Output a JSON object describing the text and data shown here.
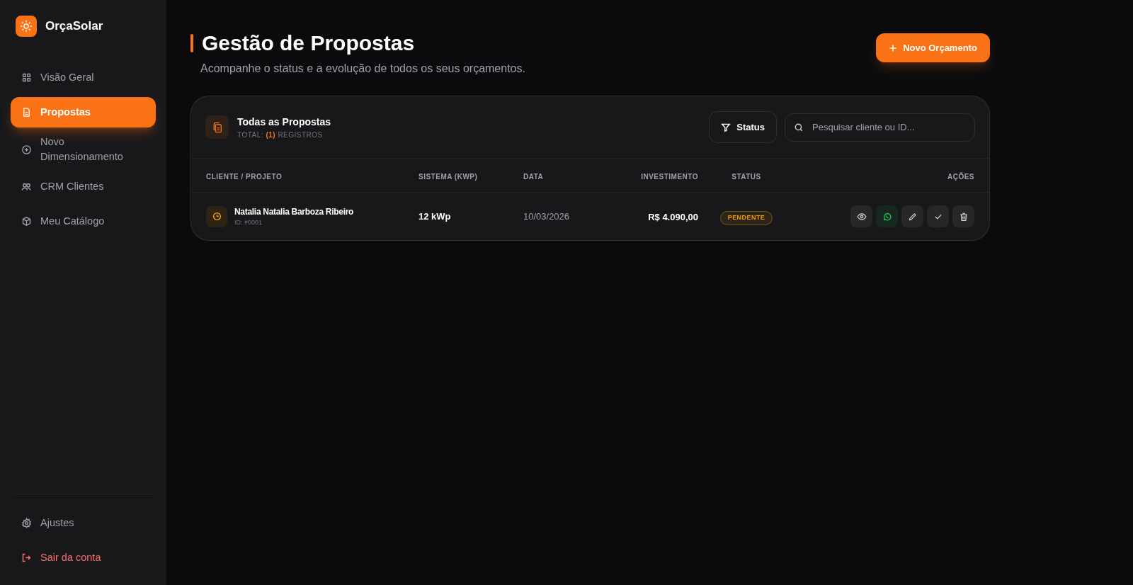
{
  "brand": {
    "name": "OrçaSolar"
  },
  "sidebar": {
    "items": [
      {
        "label": "Visão Geral",
        "selected": false
      },
      {
        "label": "Propostas",
        "selected": true
      },
      {
        "label": "Novo Dimensionamento",
        "selected": false
      },
      {
        "label": "CRM Clientes",
        "selected": false
      },
      {
        "label": "Meu Catálogo",
        "selected": false
      }
    ],
    "footer_items": [
      {
        "label": "Ajustes",
        "kind": "normal"
      },
      {
        "label": "Sair da conta",
        "kind": "danger"
      }
    ]
  },
  "header": {
    "title": "Gestão de Propostas",
    "subtitle": "Acompanhe o status e a evolução de todos os seus orçamentos.",
    "button": "Novo Orçamento"
  },
  "panel": {
    "title": "Todas as Propostas",
    "count_prefix": "TOTAL:",
    "count": "(1)",
    "count_suffix": "REGISTROS",
    "filter_button": "Status",
    "search": {
      "placeholder": "Pesquisar cliente ou ID..."
    }
  },
  "table": {
    "columns": [
      "CLIENTE / PROJETO",
      "SISTEMA (KWP)",
      "DATA",
      "INVESTIMENTO",
      "STATUS",
      "AÇÕES"
    ],
    "rows": [
      {
        "client": "Natalia Natalia Barboza Ribeiro",
        "id": "ID: #0001",
        "system": "12 kWp",
        "date": "10/03/2026",
        "investment": "R$ 4.090,00",
        "status": "PENDENTE",
        "color": "#f59e0b"
      }
    ]
  }
}
